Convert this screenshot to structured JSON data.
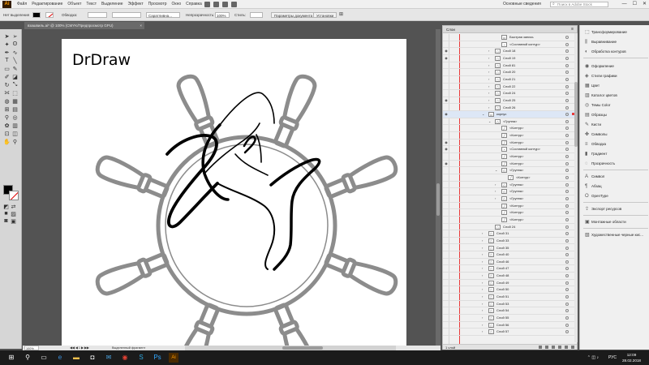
{
  "menubar": {
    "logo": "Ai",
    "items": [
      "Файл",
      "Редактирование",
      "Объект",
      "Текст",
      "Выделение",
      "Эффект",
      "Просмотр",
      "Окно",
      "Справка"
    ],
    "workspace": "Основные сведения",
    "stock_search_placeholder": "Поиск в Adobe Stock",
    "win_min": "—",
    "win_max": "☐",
    "win_close": "✕"
  },
  "controlbar": {
    "no_selection": "Нет выделения",
    "stroke_label": "Обводка:",
    "brush_name": "Сара­тливна...",
    "opacity_label": "Непрозрачность:",
    "opacity_value": "100%",
    "style_label": "Стиль:",
    "doc_params_button": "Параметры документа",
    "prefs_button": "Установки"
  },
  "document": {
    "tab_title": "взашвиль.ai* @ 100% (CMYK/Предпросмотр GPU)",
    "tab_close": "×",
    "artboard_title": "DrDraw"
  },
  "statusbar": {
    "zoom": "100%",
    "artboard_nav": "◀◀ ◀ 1 ▶ ▶▶",
    "selection_tool": "Выделенный фрагмент"
  },
  "layers_panel": {
    "title": "Слои",
    "menu_icon": "≡",
    "footer_count": "1 слой",
    "rows": [
      {
        "name": "Быстрая запись",
        "indent": 2,
        "exp": "",
        "eye": false,
        "thumb": "▭"
      },
      {
        "name": "<Составной контур>",
        "indent": 2,
        "exp": "",
        "eye": false,
        "thumb": "◔"
      },
      {
        "name": "Слой 18",
        "indent": 1,
        "exp": "›",
        "eye": true,
        "thumb": "▯"
      },
      {
        "name": "Слой 19",
        "indent": 1,
        "exp": "›",
        "eye": true,
        "thumb": "▯"
      },
      {
        "name": "Слой 81",
        "indent": 1,
        "exp": "›",
        "eye": false,
        "thumb": "▯"
      },
      {
        "name": "Слой 20",
        "indent": 1,
        "exp": "›",
        "eye": false,
        "thumb": "▯"
      },
      {
        "name": "Слой 21",
        "indent": 1,
        "exp": "›",
        "eye": false,
        "thumb": "▯"
      },
      {
        "name": "Слой 22",
        "indent": 1,
        "exp": "›",
        "eye": false,
        "thumb": "▯"
      },
      {
        "name": "Слой 24",
        "indent": 1,
        "exp": "›",
        "eye": false,
        "thumb": "▯"
      },
      {
        "name": "Слой 25",
        "indent": 1,
        "exp": "›",
        "eye": true,
        "thumb": "▯"
      },
      {
        "name": "Слой 26",
        "indent": 1,
        "exp": "›",
        "eye": false,
        "thumb": "▯"
      },
      {
        "name": "корпус",
        "indent": 0,
        "exp": "⌄",
        "eye": true,
        "thumb": "▭",
        "sel": true
      },
      {
        "name": "<Группа>",
        "indent": 1,
        "exp": "⌄",
        "eye": false,
        "thumb": "◇"
      },
      {
        "name": "<Контур>",
        "indent": 2,
        "exp": "",
        "eye": false,
        "thumb": "╱"
      },
      {
        "name": "<Контур>",
        "indent": 2,
        "exp": "",
        "eye": false,
        "thumb": "╱"
      },
      {
        "name": "<Контур>",
        "indent": 2,
        "exp": "",
        "eye": true,
        "thumb": "╱"
      },
      {
        "name": "<Составной контур>",
        "indent": 2,
        "exp": "",
        "eye": true,
        "thumb": "◔"
      },
      {
        "name": "<Контур>",
        "indent": 2,
        "exp": "",
        "eye": false,
        "thumb": "╱"
      },
      {
        "name": "<Контур>",
        "indent": 2,
        "exp": "",
        "eye": true,
        "thumb": "╱"
      },
      {
        "name": "<Группа>",
        "indent": 2,
        "exp": "⌄",
        "eye": false,
        "thumb": "◇"
      },
      {
        "name": "<Контур>",
        "indent": 3,
        "exp": "",
        "eye": false,
        "thumb": "╱"
      },
      {
        "name": "<Группа>",
        "indent": 2,
        "exp": "›",
        "eye": false,
        "thumb": "◇"
      },
      {
        "name": "<Группа>",
        "indent": 2,
        "exp": "›",
        "eye": false,
        "thumb": "◇"
      },
      {
        "name": "<Группа>",
        "indent": 2,
        "exp": "›",
        "eye": false,
        "thumb": "◇"
      },
      {
        "name": "<Контур>",
        "indent": 2,
        "exp": "",
        "eye": false,
        "thumb": "╱"
      },
      {
        "name": "<Контур>",
        "indent": 2,
        "exp": "",
        "eye": false,
        "thumb": "╱"
      },
      {
        "name": "<Контур>",
        "indent": 2,
        "exp": "",
        "eye": false,
        "thumb": "╱"
      },
      {
        "name": "Слой 24",
        "indent": 1,
        "exp": "",
        "eye": false,
        "thumb": "▯"
      },
      {
        "name": "Слой 31",
        "indent": 0,
        "exp": "›",
        "eye": false,
        "thumb": "▯"
      },
      {
        "name": "Слой 33",
        "indent": 0,
        "exp": "›",
        "eye": false,
        "thumb": "▯"
      },
      {
        "name": "Слой 35",
        "indent": 0,
        "exp": "›",
        "eye": false,
        "thumb": "▯"
      },
      {
        "name": "Слой 40",
        "indent": 0,
        "exp": "›",
        "eye": false,
        "thumb": "▯"
      },
      {
        "name": "Слой 46",
        "indent": 0,
        "exp": "›",
        "eye": false,
        "thumb": "▯"
      },
      {
        "name": "Слой 47",
        "indent": 0,
        "exp": "›",
        "eye": false,
        "thumb": "▯"
      },
      {
        "name": "Слой 48",
        "indent": 0,
        "exp": "›",
        "eye": false,
        "thumb": "▯"
      },
      {
        "name": "Слой 49",
        "indent": 0,
        "exp": "›",
        "eye": false,
        "thumb": "▯"
      },
      {
        "name": "Слой 50",
        "indent": 0,
        "exp": "›",
        "eye": false,
        "thumb": "▯"
      },
      {
        "name": "Слой 51",
        "indent": 0,
        "exp": "›",
        "eye": false,
        "thumb": "▯"
      },
      {
        "name": "Слой 53",
        "indent": 0,
        "exp": "›",
        "eye": false,
        "thumb": "▯"
      },
      {
        "name": "Слой 54",
        "indent": 0,
        "exp": "›",
        "eye": false,
        "thumb": "▯"
      },
      {
        "name": "Слой 55",
        "indent": 0,
        "exp": "›",
        "eye": false,
        "thumb": "▯"
      },
      {
        "name": "Слой 56",
        "indent": 0,
        "exp": "›",
        "eye": false,
        "thumb": "▯"
      },
      {
        "name": "Слой 57",
        "indent": 0,
        "exp": "›",
        "eye": false,
        "thumb": "▯"
      }
    ]
  },
  "dock": {
    "items": [
      {
        "icon": "⬚",
        "label": "Трансформирование"
      },
      {
        "icon": "⫼",
        "label": "Выравнивание"
      },
      {
        "icon": "◐",
        "label": "Обработка контуров"
      },
      {
        "icon": "◉",
        "label": "Оформление"
      },
      {
        "icon": "◈",
        "label": "Стили графики"
      },
      {
        "icon": "▦",
        "label": "Цвет"
      },
      {
        "icon": "▥",
        "label": "Каталог цветов"
      },
      {
        "icon": "◎",
        "label": "Темы Color"
      },
      {
        "icon": "▤",
        "label": "Образцы"
      },
      {
        "icon": "✎",
        "label": "Кисти"
      },
      {
        "icon": "✤",
        "label": "Символы"
      },
      {
        "icon": "≡",
        "label": "Обводка"
      },
      {
        "icon": "▮",
        "label": "Градиент"
      },
      {
        "icon": "◌",
        "label": "Прозрачность"
      },
      {
        "icon": "A",
        "label": "Символ"
      },
      {
        "icon": "¶",
        "label": "Абзац"
      },
      {
        "icon": "O",
        "label": "OpenType"
      },
      {
        "icon": "⇪",
        "label": "Экспорт ресурсов"
      },
      {
        "icon": "▣",
        "label": "Монтажные области"
      },
      {
        "icon": "▧",
        "label": "Художественные черные кис..."
      }
    ]
  },
  "taskbar": {
    "lang": "РУС",
    "time": "12:09",
    "date": "28.02.2018",
    "tray": "⌃ ◫ ♪"
  },
  "colors": {
    "ai_accent": "#ff9a00",
    "layer_color": "#e83b3b",
    "fill": "#000000",
    "stroke_none": "#e00000"
  }
}
